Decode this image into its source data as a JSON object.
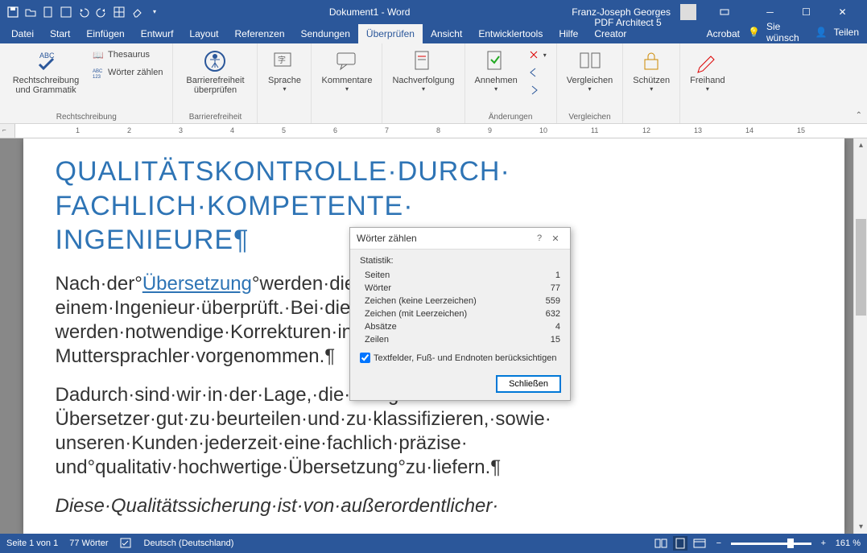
{
  "title": {
    "document": "Dokument1",
    "app": "Word",
    "user": "Franz-Joseph Georges"
  },
  "tabs": {
    "file": "Datei",
    "items": [
      "Start",
      "Einfügen",
      "Entwurf",
      "Layout",
      "Referenzen",
      "Sendungen",
      "Überprüfen",
      "Ansicht",
      "Entwicklertools",
      "Hilfe",
      "PDF Architect 5 Creator",
      "Acrobat"
    ],
    "active": "Überprüfen",
    "search": "Sie wünsch",
    "share": "Teilen"
  },
  "ribbon": {
    "groups": {
      "rechtschreibung": {
        "label": "Rechtschreibung",
        "spelling": "Rechtschreibung und Grammatik",
        "thesaurus": "Thesaurus",
        "wordcount": "Wörter zählen"
      },
      "barrierefreiheit": {
        "label": "Barrierefreiheit",
        "check": "Barrierefreiheit überprüfen"
      },
      "sprache": {
        "label": "",
        "btn": "Sprache"
      },
      "kommentare": {
        "label": "",
        "btn": "Kommentare"
      },
      "nachverfolgung": {
        "label": "",
        "btn": "Nachverfolgung"
      },
      "aenderungen": {
        "label": "Änderungen",
        "annehmen": "Annehmen"
      },
      "vergleichen": {
        "label": "Vergleichen",
        "btn": "Vergleichen"
      },
      "schuetzen": {
        "label": "",
        "btn": "Schützen"
      },
      "freihand": {
        "label": "",
        "btn": "Freihand"
      }
    }
  },
  "document": {
    "heading": "QUALITÄTSKONTROLLE·DURCH·FACHLICH·KOMPETENTE·INGENIEURE¶",
    "p1_prefix": "Nach·der°",
    "p1_link": "Übersetzung",
    "p1_rest": "°werden·die·Te",
    "p1_l2": "einem·Ingenieur·überprüft.·Bei·dieser",
    "p1_l3": "werden·notwendige·Korrekturen·in·Rü",
    "p1_l4": "Muttersprachler·vorgenommen.¶",
    "p2": "Dadurch·sind·wir·in·der·Lage,·die·Fähigkeiten·der·Übersetzer·gut·zu·beurteilen·und·zu·klassifizieren,·sowie·unseren·Kunden·jederzeit·eine·fachlich·präzise·und°qualitativ·hochwertige·Übersetzung°zu·liefern.¶",
    "p3": "Diese·Qualitätssicherung·ist·von·außerordentlicher·"
  },
  "dialog": {
    "title": "Wörter zählen",
    "stats_label": "Statistik:",
    "rows": [
      {
        "label": "Seiten",
        "value": "1"
      },
      {
        "label": "Wörter",
        "value": "77"
      },
      {
        "label": "Zeichen (keine Leerzeichen)",
        "value": "559"
      },
      {
        "label": "Zeichen (mit Leerzeichen)",
        "value": "632"
      },
      {
        "label": "Absätze",
        "value": "4"
      },
      {
        "label": "Zeilen",
        "value": "15"
      }
    ],
    "checkbox": "Textfelder, Fuß- und Endnoten berücksichtigen",
    "close": "Schließen"
  },
  "status": {
    "page": "Seite 1 von 1",
    "words": "77 Wörter",
    "language": "Deutsch (Deutschland)",
    "zoom": "161 %"
  },
  "ruler_marks": [
    "1",
    "2",
    "3",
    "4",
    "5",
    "6",
    "7",
    "8",
    "9",
    "10",
    "11",
    "12",
    "13",
    "14",
    "15"
  ]
}
